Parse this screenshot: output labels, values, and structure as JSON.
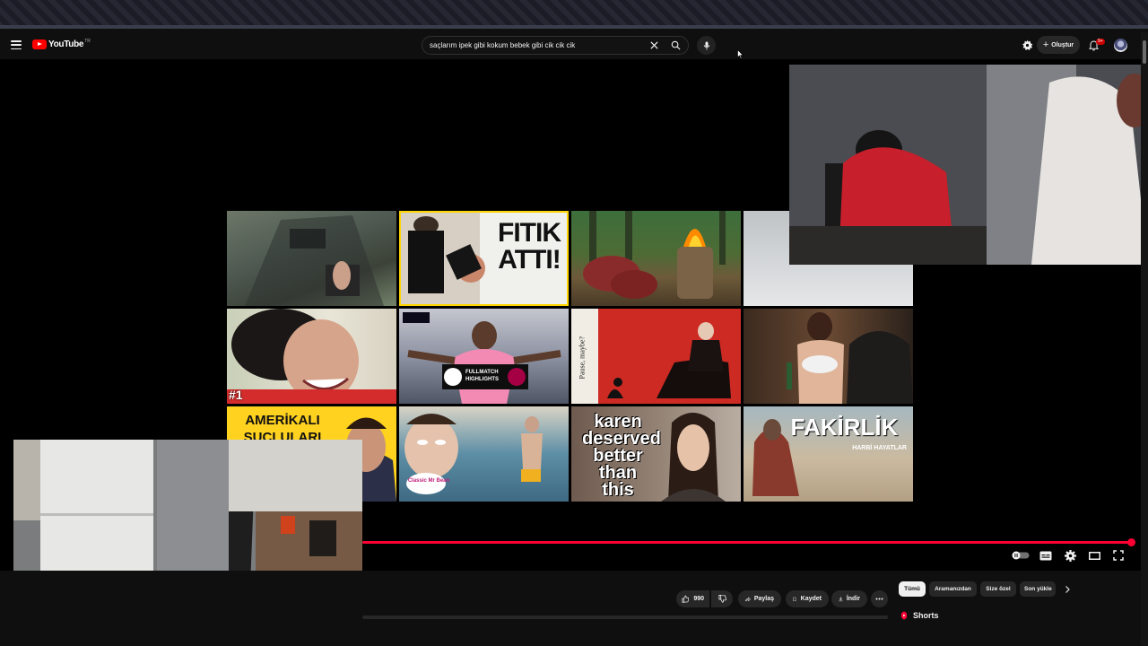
{
  "header": {
    "logo_text": "YouTube",
    "logo_region": "TR",
    "search_value": "saçlarım ipek gibi kokum bebek gibi cik cik cik",
    "create_label": "Oluştur",
    "notification_count": "9+"
  },
  "end_screen": {
    "tiles": [
      {
        "caption": ""
      },
      {
        "caption": "FITIK ATTI!"
      },
      {
        "caption": ""
      },
      {
        "caption": ""
      },
      {
        "caption": "#1"
      },
      {
        "caption": "FULLMATCH HIGHLIGHTS"
      },
      {
        "caption": "Pause, maybe?"
      },
      {
        "caption": ""
      },
      {
        "caption": "AMERİKALI SUÇLULARI DİZE GETİREN TÜRK"
      },
      {
        "caption": "Classic Mr Bean"
      },
      {
        "caption": "karen deserved better than this"
      },
      {
        "caption": "FAKİRLİK"
      }
    ],
    "fakirlik_subtitle": "HARBİ HAYATLAR"
  },
  "player": {
    "progress_fraction": 0.99
  },
  "actions": {
    "like_count": "990",
    "share_label": "Paylaş",
    "save_label": "Kaydet",
    "download_label": "İndir"
  },
  "chips": [
    "Tümü",
    "Aramanızdan",
    "Size özel",
    "Son yükle"
  ],
  "sidebar": {
    "shorts_title": "Shorts"
  },
  "colors": {
    "accent": "#ff0033",
    "background": "#0f0f0f"
  }
}
